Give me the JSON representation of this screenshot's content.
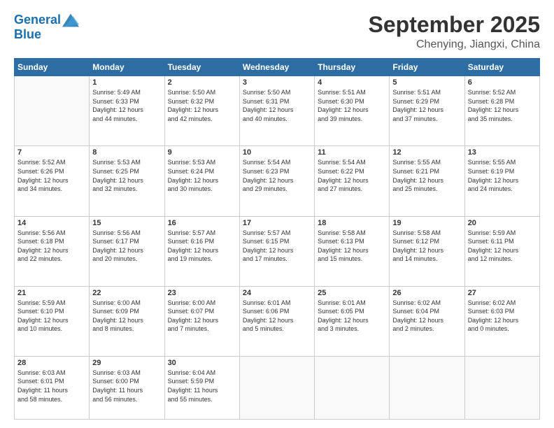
{
  "logo": {
    "line1": "General",
    "line2": "Blue"
  },
  "title": "September 2025",
  "subtitle": "Chenying, Jiangxi, China",
  "weekdays": [
    "Sunday",
    "Monday",
    "Tuesday",
    "Wednesday",
    "Thursday",
    "Friday",
    "Saturday"
  ],
  "weeks": [
    [
      {
        "day": "",
        "info": ""
      },
      {
        "day": "1",
        "info": "Sunrise: 5:49 AM\nSunset: 6:33 PM\nDaylight: 12 hours\nand 44 minutes."
      },
      {
        "day": "2",
        "info": "Sunrise: 5:50 AM\nSunset: 6:32 PM\nDaylight: 12 hours\nand 42 minutes."
      },
      {
        "day": "3",
        "info": "Sunrise: 5:50 AM\nSunset: 6:31 PM\nDaylight: 12 hours\nand 40 minutes."
      },
      {
        "day": "4",
        "info": "Sunrise: 5:51 AM\nSunset: 6:30 PM\nDaylight: 12 hours\nand 39 minutes."
      },
      {
        "day": "5",
        "info": "Sunrise: 5:51 AM\nSunset: 6:29 PM\nDaylight: 12 hours\nand 37 minutes."
      },
      {
        "day": "6",
        "info": "Sunrise: 5:52 AM\nSunset: 6:28 PM\nDaylight: 12 hours\nand 35 minutes."
      }
    ],
    [
      {
        "day": "7",
        "info": "Sunrise: 5:52 AM\nSunset: 6:26 PM\nDaylight: 12 hours\nand 34 minutes."
      },
      {
        "day": "8",
        "info": "Sunrise: 5:53 AM\nSunset: 6:25 PM\nDaylight: 12 hours\nand 32 minutes."
      },
      {
        "day": "9",
        "info": "Sunrise: 5:53 AM\nSunset: 6:24 PM\nDaylight: 12 hours\nand 30 minutes."
      },
      {
        "day": "10",
        "info": "Sunrise: 5:54 AM\nSunset: 6:23 PM\nDaylight: 12 hours\nand 29 minutes."
      },
      {
        "day": "11",
        "info": "Sunrise: 5:54 AM\nSunset: 6:22 PM\nDaylight: 12 hours\nand 27 minutes."
      },
      {
        "day": "12",
        "info": "Sunrise: 5:55 AM\nSunset: 6:21 PM\nDaylight: 12 hours\nand 25 minutes."
      },
      {
        "day": "13",
        "info": "Sunrise: 5:55 AM\nSunset: 6:19 PM\nDaylight: 12 hours\nand 24 minutes."
      }
    ],
    [
      {
        "day": "14",
        "info": "Sunrise: 5:56 AM\nSunset: 6:18 PM\nDaylight: 12 hours\nand 22 minutes."
      },
      {
        "day": "15",
        "info": "Sunrise: 5:56 AM\nSunset: 6:17 PM\nDaylight: 12 hours\nand 20 minutes."
      },
      {
        "day": "16",
        "info": "Sunrise: 5:57 AM\nSunset: 6:16 PM\nDaylight: 12 hours\nand 19 minutes."
      },
      {
        "day": "17",
        "info": "Sunrise: 5:57 AM\nSunset: 6:15 PM\nDaylight: 12 hours\nand 17 minutes."
      },
      {
        "day": "18",
        "info": "Sunrise: 5:58 AM\nSunset: 6:13 PM\nDaylight: 12 hours\nand 15 minutes."
      },
      {
        "day": "19",
        "info": "Sunrise: 5:58 AM\nSunset: 6:12 PM\nDaylight: 12 hours\nand 14 minutes."
      },
      {
        "day": "20",
        "info": "Sunrise: 5:59 AM\nSunset: 6:11 PM\nDaylight: 12 hours\nand 12 minutes."
      }
    ],
    [
      {
        "day": "21",
        "info": "Sunrise: 5:59 AM\nSunset: 6:10 PM\nDaylight: 12 hours\nand 10 minutes."
      },
      {
        "day": "22",
        "info": "Sunrise: 6:00 AM\nSunset: 6:09 PM\nDaylight: 12 hours\nand 8 minutes."
      },
      {
        "day": "23",
        "info": "Sunrise: 6:00 AM\nSunset: 6:07 PM\nDaylight: 12 hours\nand 7 minutes."
      },
      {
        "day": "24",
        "info": "Sunrise: 6:01 AM\nSunset: 6:06 PM\nDaylight: 12 hours\nand 5 minutes."
      },
      {
        "day": "25",
        "info": "Sunrise: 6:01 AM\nSunset: 6:05 PM\nDaylight: 12 hours\nand 3 minutes."
      },
      {
        "day": "26",
        "info": "Sunrise: 6:02 AM\nSunset: 6:04 PM\nDaylight: 12 hours\nand 2 minutes."
      },
      {
        "day": "27",
        "info": "Sunrise: 6:02 AM\nSunset: 6:03 PM\nDaylight: 12 hours\nand 0 minutes."
      }
    ],
    [
      {
        "day": "28",
        "info": "Sunrise: 6:03 AM\nSunset: 6:01 PM\nDaylight: 11 hours\nand 58 minutes."
      },
      {
        "day": "29",
        "info": "Sunrise: 6:03 AM\nSunset: 6:00 PM\nDaylight: 11 hours\nand 56 minutes."
      },
      {
        "day": "30",
        "info": "Sunrise: 6:04 AM\nSunset: 5:59 PM\nDaylight: 11 hours\nand 55 minutes."
      },
      {
        "day": "",
        "info": ""
      },
      {
        "day": "",
        "info": ""
      },
      {
        "day": "",
        "info": ""
      },
      {
        "day": "",
        "info": ""
      }
    ]
  ]
}
